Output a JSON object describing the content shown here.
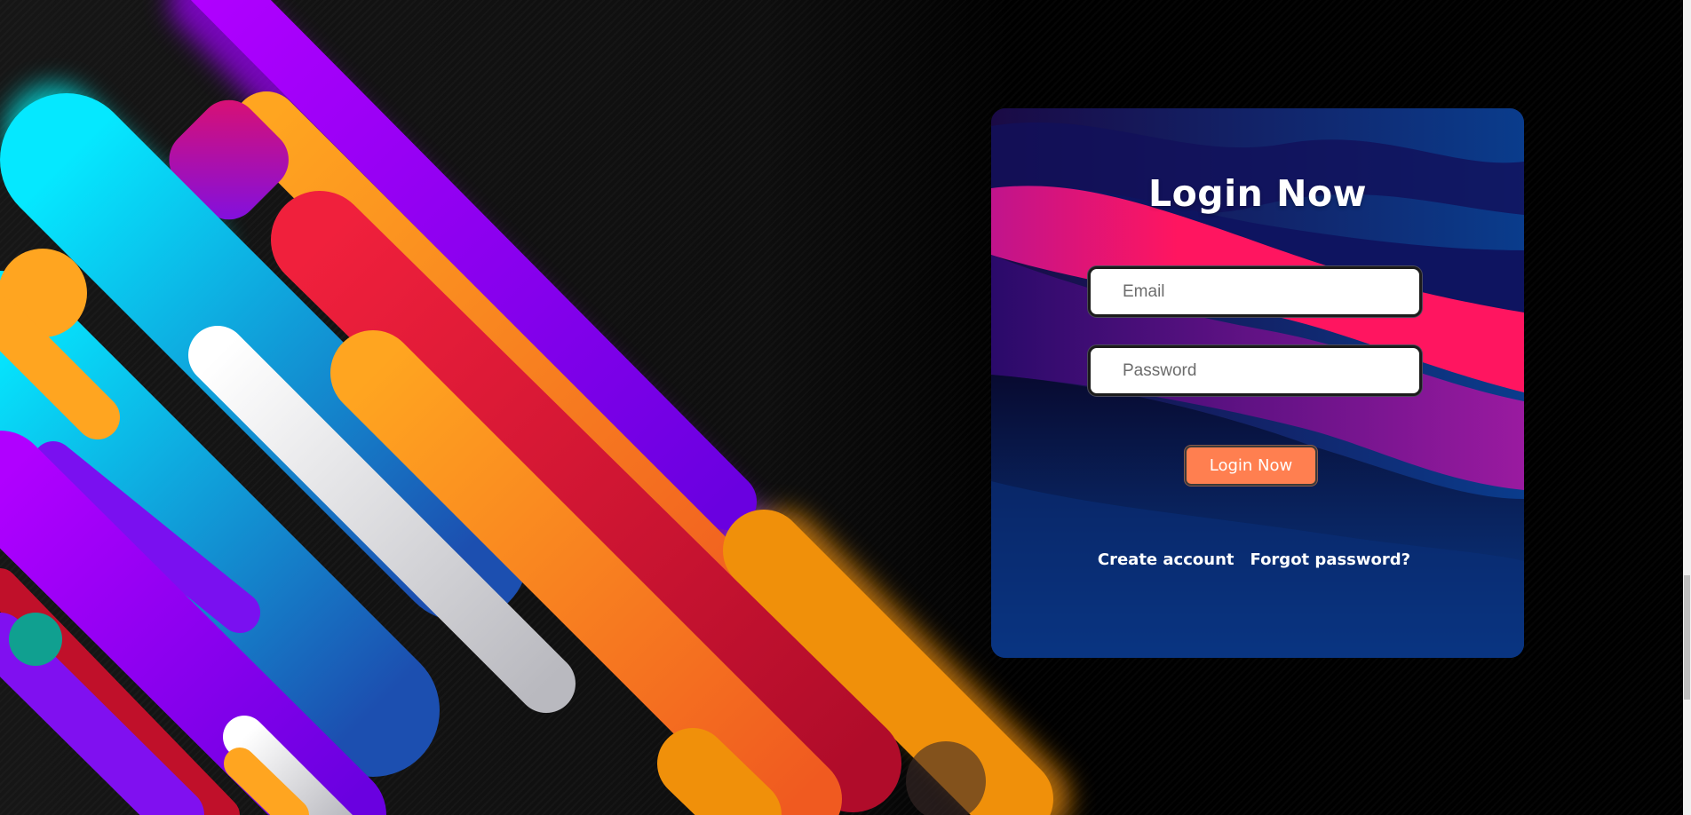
{
  "login": {
    "title": "Login Now",
    "email_placeholder": "Email",
    "password_placeholder": "Password",
    "submit_label": "Login Now"
  },
  "links": {
    "create_account": "Create account",
    "forgot_password": "Forgot password?"
  },
  "colors": {
    "button": "#ff7f50",
    "card_dark": "#0b0f3c",
    "card_blue": "#0a2a6e",
    "wave_pink": "#ff1560",
    "wave_purple": "#a020a0"
  }
}
